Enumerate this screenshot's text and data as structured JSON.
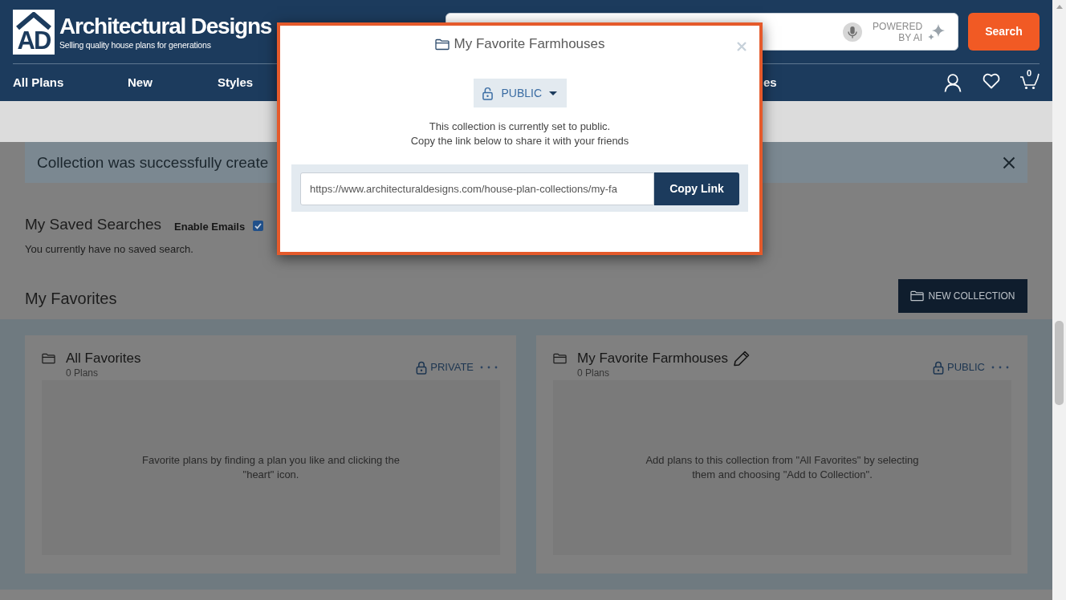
{
  "header": {
    "logo": {
      "mark": "AD",
      "wordmark": "Architectural Designs",
      "tagline": "Selling quality house plans for generations"
    },
    "search": {
      "powered_by": [
        "POWERED",
        "BY AI"
      ],
      "button": "Search"
    },
    "nav": [
      {
        "label": "All Plans"
      },
      {
        "label": "New"
      },
      {
        "label": "Styles"
      },
      {
        "label": "es"
      }
    ],
    "cart_count": "0"
  },
  "modal": {
    "title": "My Favorite Farmhouses",
    "visibility": "PUBLIC",
    "message": [
      "This collection is currently set to public.",
      "Copy the link below to share it with your friends"
    ],
    "link": {
      "value": "https://www.architecturaldesigns.com/house-plan-collections/my-fa"
    },
    "copy_button": "Copy Link"
  },
  "alert": {
    "message": "Collection was successfully create"
  },
  "saved_searches": {
    "title": "My Saved Searches",
    "enable_emails": {
      "label": "Enable Emails",
      "checked": true
    },
    "empty_text": "You currently have no saved search."
  },
  "favorites": {
    "title": "My Favorites",
    "new_collection_button": "NEW COLLECTION",
    "collections": [
      {
        "title": "All Favorites",
        "editable": false,
        "count": "0 Plans",
        "privacy": "PRIVATE",
        "empty_text": "Favorite plans by finding a plan you like and clicking the \"heart\" icon."
      },
      {
        "title": "My Favorite Farmhouses",
        "editable": true,
        "count": "0 Plans",
        "privacy": "PUBLIC",
        "empty_text": "Add plans to this collection from \"All Favorites\" by selecting them and choosing \"Add to Collection\"."
      }
    ]
  }
}
